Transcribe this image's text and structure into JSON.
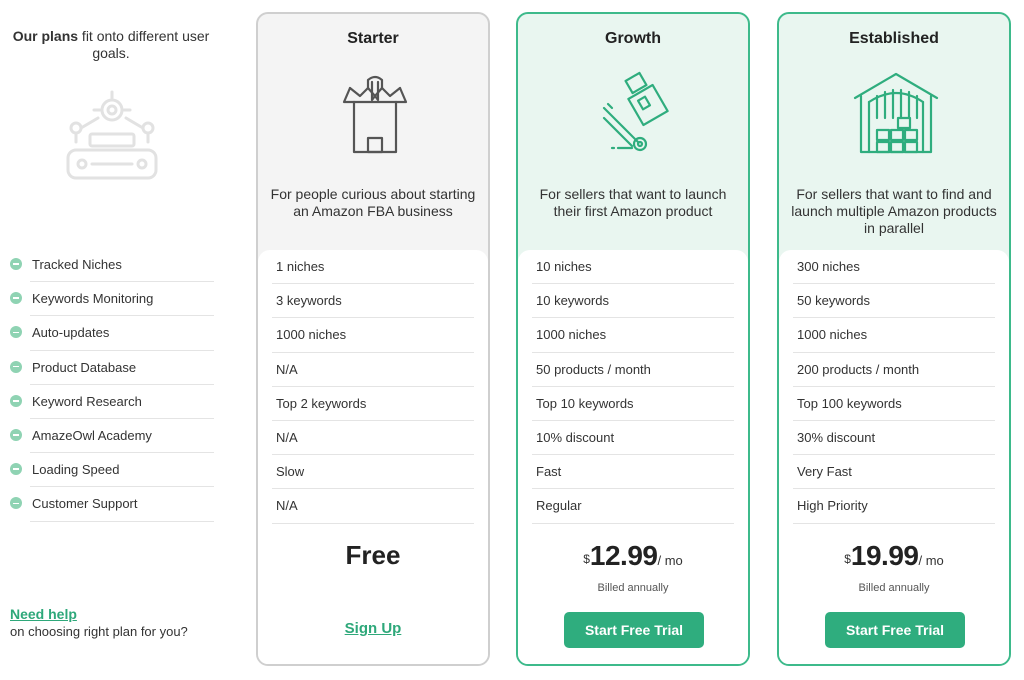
{
  "intro": {
    "bold": "Our plans",
    "rest": " fit onto different user goals."
  },
  "features": [
    "Tracked Niches",
    "Keywords Monitoring",
    "Auto-updates",
    "Product Database",
    "Keyword Research",
    "AmazeOwl Academy",
    "Loading Speed",
    "Customer Support"
  ],
  "help": {
    "link": "Need help",
    "text": "on choosing right plan for you?"
  },
  "plans": [
    {
      "title": "Starter",
      "description": "For people curious about starting an Amazon FBA business",
      "rows": [
        "1 niches",
        "3 keywords",
        "1000 niches",
        "N/A",
        "Top 2 keywords",
        "N/A",
        "Slow",
        "N/A"
      ],
      "price_label": "Free",
      "cta": "Sign Up"
    },
    {
      "title": "Growth",
      "description": "For sellers that want to launch their first Amazon product",
      "rows": [
        "10 niches",
        "10 keywords",
        "1000 niches",
        "50 products / month",
        "Top 10 keywords",
        "10% discount",
        "Fast",
        "Regular"
      ],
      "currency": "$",
      "price": "12.99",
      "period": "/ mo",
      "billed": "Billed annually",
      "cta": "Start Free Trial"
    },
    {
      "title": "Established",
      "description": "For sellers that want to find and launch multiple Amazon products in parallel",
      "rows": [
        "300 niches",
        "50 keywords",
        "1000 niches",
        "200 products / month",
        "Top 100 keywords",
        "30% discount",
        "Very Fast",
        "High Priority"
      ],
      "currency": "$",
      "price": "19.99",
      "period": "/ mo",
      "billed": "Billed annually",
      "cta": "Start Free Trial"
    }
  ],
  "colors": {
    "accent": "#2fad7e",
    "accent_light": "#e9f6f0",
    "border_gray": "#cfcfcf"
  },
  "icons": [
    "factory-icon",
    "castle-box-icon",
    "dolly-icon",
    "warehouse-icon",
    "feature-dot-icon"
  ]
}
